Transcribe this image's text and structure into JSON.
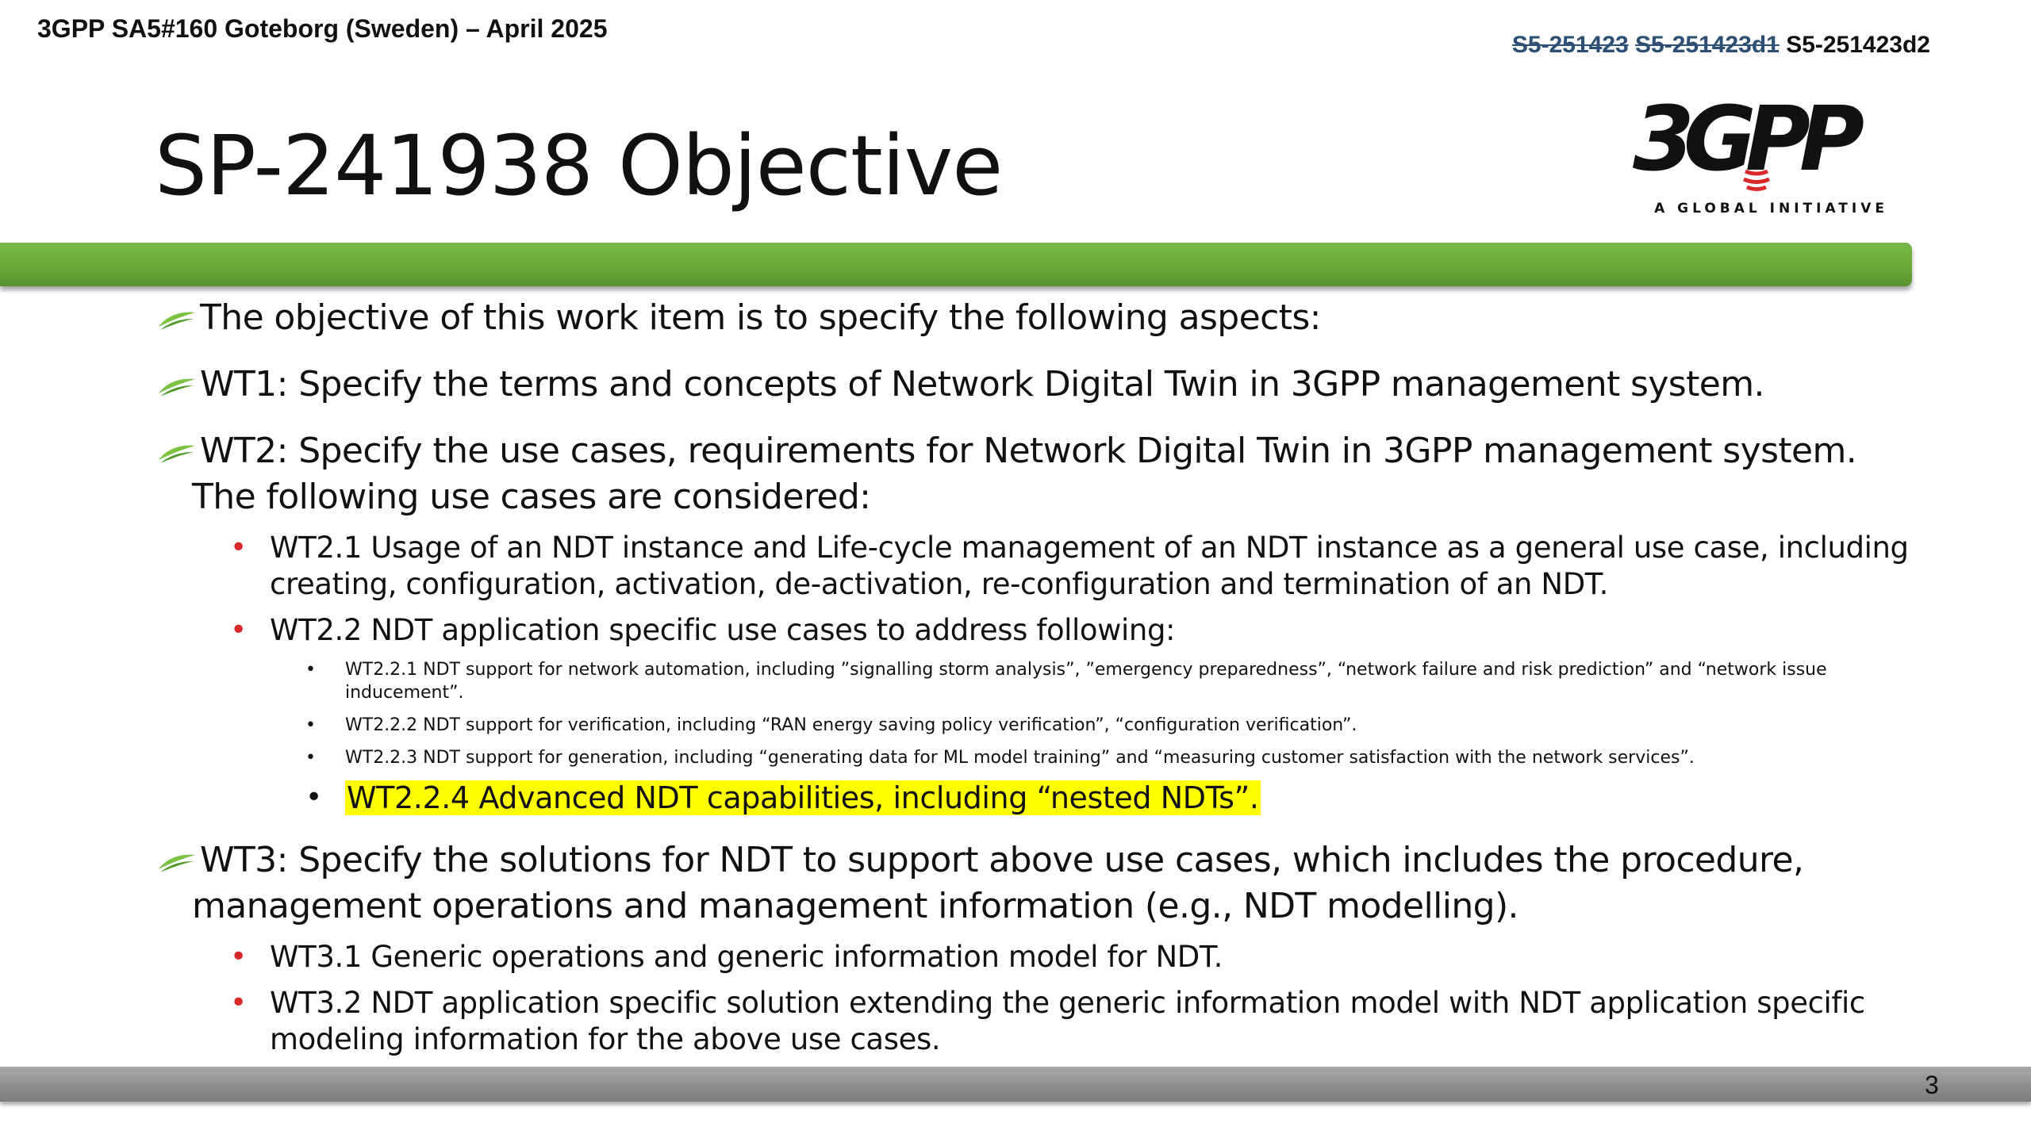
{
  "header": {
    "meeting": "3GPP SA5#160 Goteborg (Sweden) – April 2025",
    "doc_ids": {
      "struck_1": "S5-251423",
      "struck_2": "S5-251423d1",
      "current": "S5-251423d2"
    },
    "logo": {
      "wordmark": "3GPP",
      "tagline": "A GLOBAL INITIATIVE"
    }
  },
  "slide": {
    "title": "SP-241938 Objective",
    "page_number": "3",
    "intro": "The objective of this work item is to specify the following aspects:",
    "wt1": "WT1: Specify the terms and concepts of Network Digital Twin in 3GPP management system.",
    "wt2": {
      "line1": "WT2: Specify the use cases, requirements for Network Digital Twin in 3GPP management system.",
      "line2": "The following use cases are considered:",
      "sub": [
        {
          "line1": "WT2.1 Usage of an NDT instance and Life-cycle management of an NDT instance as a general use case, including",
          "line2": "creating, configuration, activation, de-activation, re-configuration and termination of an NDT."
        },
        {
          "line1": "WT2.2 NDT application specific use cases to address following:"
        }
      ],
      "subsub": [
        {
          "line1": "WT2.2.1 NDT support for network automation, including ”signalling storm analysis”, ”emergency preparedness”, “network failure and risk prediction” and “network issue",
          "line2": "inducement”."
        },
        {
          "line1": "WT2.2.2 NDT support for verification, including “RAN energy saving policy verification”, “configuration verification”."
        },
        {
          "line1": "WT2.2.3 NDT support for generation, including “generating data for ML model training” and “measuring customer satisfaction with the network services”."
        },
        {
          "line1": "WT2.2.4 Advanced NDT capabilities, including “nested NDTs”."
        }
      ]
    },
    "wt3": {
      "line1": "WT3: Specify the solutions for NDT to support above use cases, which includes the procedure,",
      "line2": "management operations and management information (e.g., NDT modelling).",
      "sub": [
        {
          "line1": "WT3.1 Generic operations and generic information model for NDT."
        },
        {
          "line1": "WT3.2 NDT application specific solution extending the generic information model with NDT application specific",
          "line2": "modeling information for the above use cases."
        }
      ]
    }
  },
  "colors": {
    "accent_green": "#6aa83a",
    "footer_grey": "#8c8c8c",
    "bullet_red": "#d8282a",
    "highlight": "#ffff00",
    "struck_blue": "#2c4f73"
  },
  "icons": {
    "level1_bullet": "leaf-swoosh-icon",
    "level2_bullet": "red-dot",
    "level3_bullet": "black-dot"
  }
}
